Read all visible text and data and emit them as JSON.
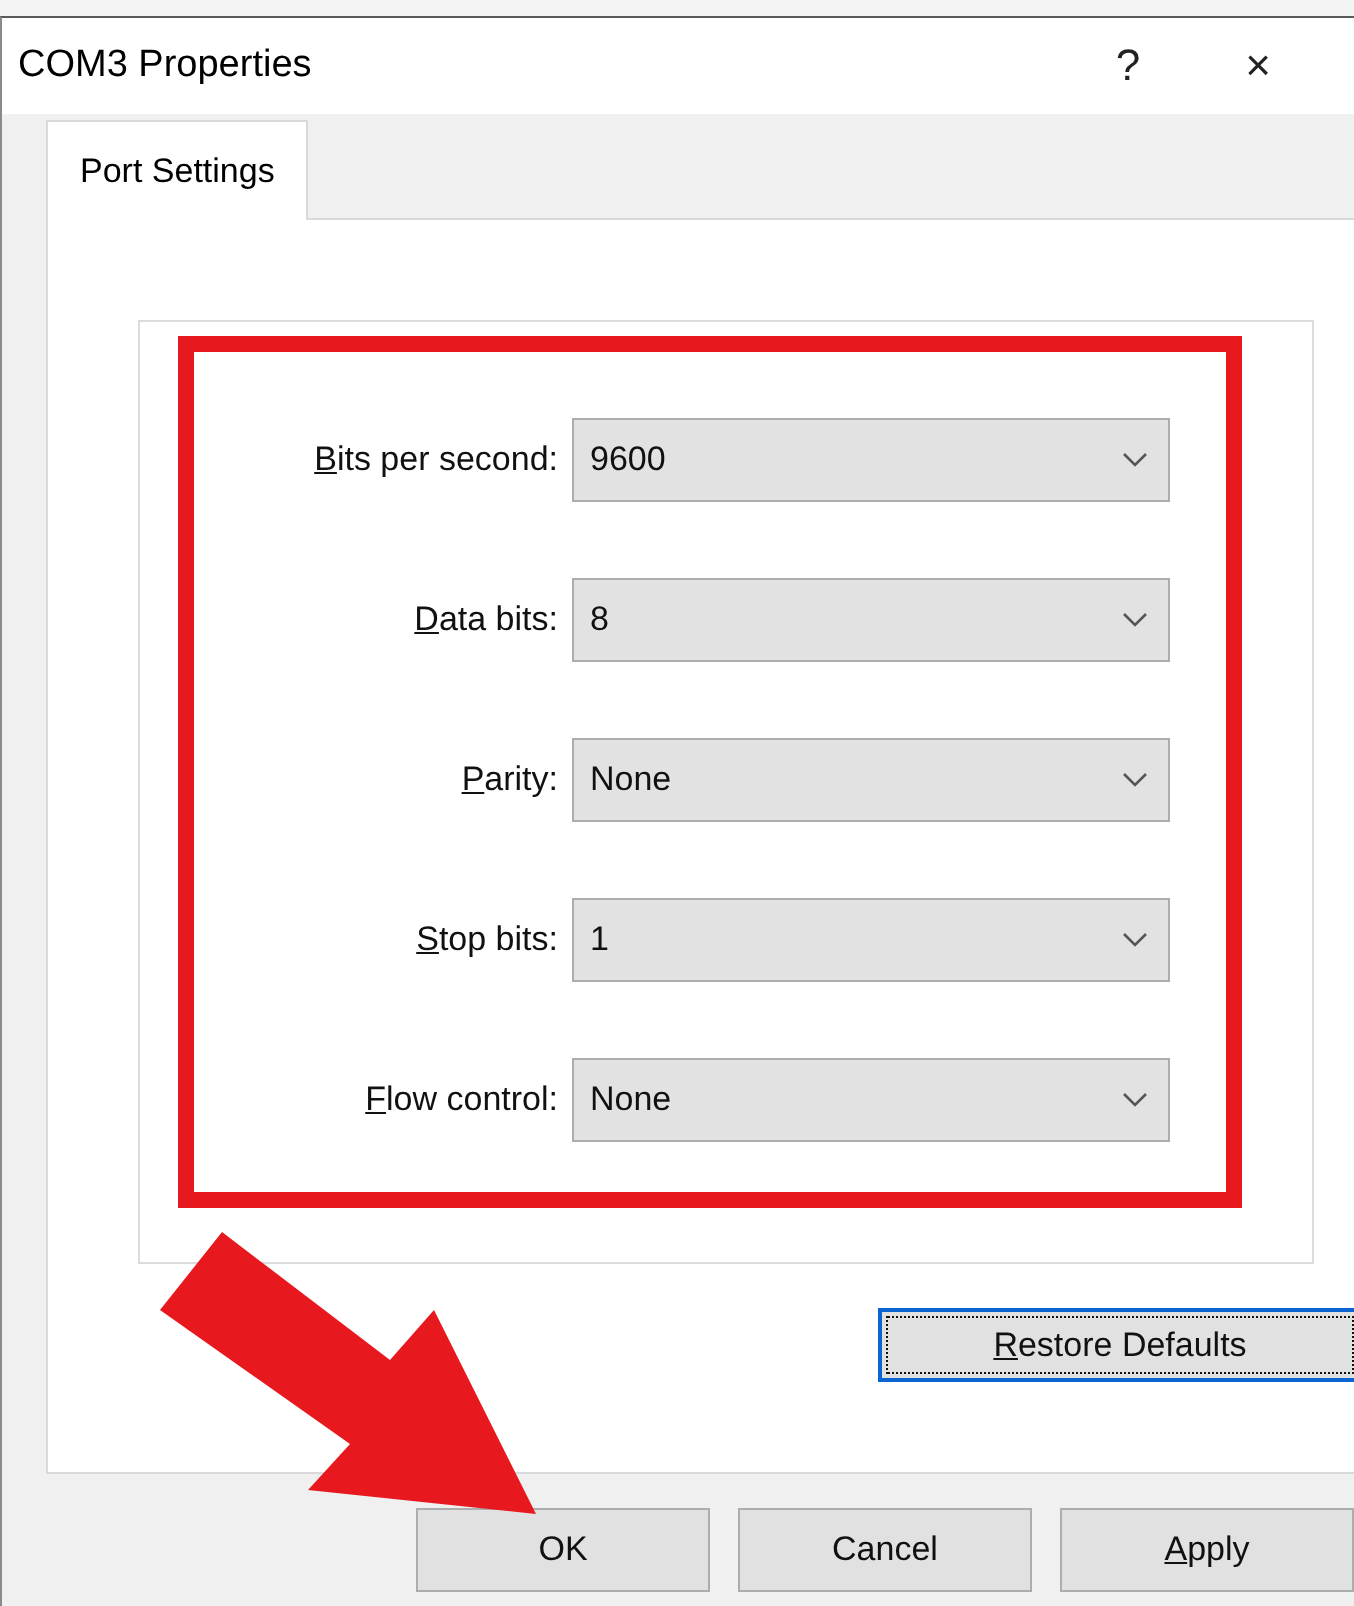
{
  "window": {
    "title": "COM3 Properties",
    "help_glyph": "?",
    "close_glyph": "×"
  },
  "tabs": [
    {
      "label": "Port Settings",
      "selected": true
    }
  ],
  "settings": [
    {
      "label": "Bits per second:",
      "mnemonic": true,
      "value": "9600"
    },
    {
      "label": "Data bits:",
      "mnemonic": true,
      "value": "8"
    },
    {
      "label": "Parity:",
      "mnemonic": true,
      "value": "None"
    },
    {
      "label": "Stop bits:",
      "mnemonic": true,
      "value": "1"
    },
    {
      "label": "Flow control:",
      "mnemonic": true,
      "value": "None"
    }
  ],
  "restore_button": {
    "label": "Restore Defaults",
    "mnemonic": true,
    "focused": true
  },
  "buttons": [
    {
      "label": "OK",
      "mnemonic": false
    },
    {
      "label": "Cancel",
      "mnemonic": false
    },
    {
      "label": "Apply",
      "mnemonic": true
    }
  ]
}
